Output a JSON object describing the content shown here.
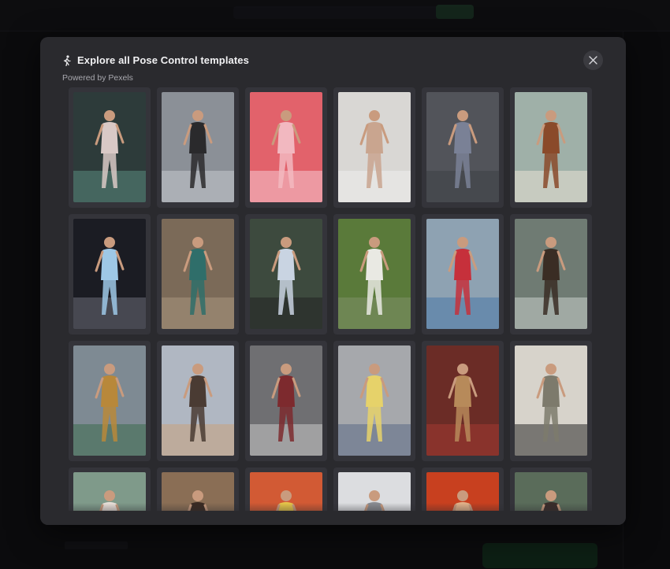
{
  "modal": {
    "title": "Explore all Pose Control templates",
    "subtitle": "Powered by Pexels",
    "title_icon": "person-walking-icon",
    "close_icon": "close-icon"
  },
  "templates": [
    {
      "name": "template-neon-alley-pose",
      "bg": "#2d3b3a",
      "fig": "#d9c9c6",
      "accent": "#5a8a7e"
    },
    {
      "name": "template-umbrella-road-pose",
      "bg": "#8b9097",
      "fig": "#2a2a2c",
      "accent": "#c6c9cd"
    },
    {
      "name": "template-pink-dress-pose",
      "bg": "#e2626b",
      "fig": "#f2b8c0",
      "accent": "#f6c7cf"
    },
    {
      "name": "template-white-wall-pose",
      "bg": "#d9d7d4",
      "fig": "#c9a58f",
      "accent": "#eeeeec"
    },
    {
      "name": "template-grey-studio-pose",
      "bg": "#52545a",
      "fig": "#7a8196",
      "accent": "#3c3f46"
    },
    {
      "name": "template-horse-rider-pose",
      "bg": "#9fb0a8",
      "fig": "#8a4a2a",
      "accent": "#e8e2d3"
    },
    {
      "name": "template-ballerina-pose",
      "bg": "#1b1c23",
      "fig": "#9ec8e6",
      "accent": "#6c6e78"
    },
    {
      "name": "template-teal-jacket-pose",
      "bg": "#7b6a58",
      "fig": "#2f6e6a",
      "accent": "#a99680"
    },
    {
      "name": "template-white-shirt-man-pose",
      "bg": "#3d4a3e",
      "fig": "#c9d4e2",
      "accent": "#222"
    },
    {
      "name": "template-park-path-pose",
      "bg": "#5a7a3a",
      "fig": "#e9e9e3",
      "accent": "#7f8f68"
    },
    {
      "name": "template-red-jacket-city-pose",
      "bg": "#8ea2b2",
      "fig": "#c6303b",
      "accent": "#4a79a8"
    },
    {
      "name": "template-motorcycle-pose",
      "bg": "#6f7b73",
      "fig": "#3a2d24",
      "accent": "#c9cfcb"
    },
    {
      "name": "template-trident-warrior-pose",
      "bg": "#7e8a93",
      "fig": "#b8883a",
      "accent": "#3d6b4e"
    },
    {
      "name": "template-rooftop-city-pose",
      "bg": "#b0b7c2",
      "fig": "#4a3b33",
      "accent": "#c9a27d"
    },
    {
      "name": "template-station-railing-pose",
      "bg": "#6f6f72",
      "fig": "#7d2a2e",
      "accent": "#c8c8c9"
    },
    {
      "name": "template-tunnel-walk-pose",
      "bg": "#a6a8ac",
      "fig": "#e6d26a",
      "accent": "#5b6a86"
    },
    {
      "name": "template-red-stairs-pose",
      "bg": "#6b2c26",
      "fig": "#b78a5a",
      "accent": "#a33a32"
    },
    {
      "name": "template-soldier-pose",
      "bg": "#d7d3cb",
      "fig": "#7d7a6c",
      "accent": "#2b2b2b"
    },
    {
      "name": "template-palm-leaves-pose",
      "bg": "#7f9a8a",
      "fig": "#e9e0d9",
      "accent": "#4f6d57"
    },
    {
      "name": "template-brown-hills-pose",
      "bg": "#8a6e55",
      "fig": "#3a2a22",
      "accent": "#b8987a"
    },
    {
      "name": "template-orange-wall-pose",
      "bg": "#d25a34",
      "fig": "#e6c64a",
      "accent": "#2b2b2b"
    },
    {
      "name": "template-cloudy-sky-pose",
      "bg": "#dcdde0",
      "fig": "#8a8c92",
      "accent": "#c2c4c8"
    },
    {
      "name": "template-red-backdrop-pose",
      "bg": "#c8401f",
      "fig": "#e2b28a",
      "accent": "#8a2a12"
    },
    {
      "name": "template-garden-plants-pose",
      "bg": "#5a6c5a",
      "fig": "#3a2d2a",
      "accent": "#9db39a"
    }
  ]
}
